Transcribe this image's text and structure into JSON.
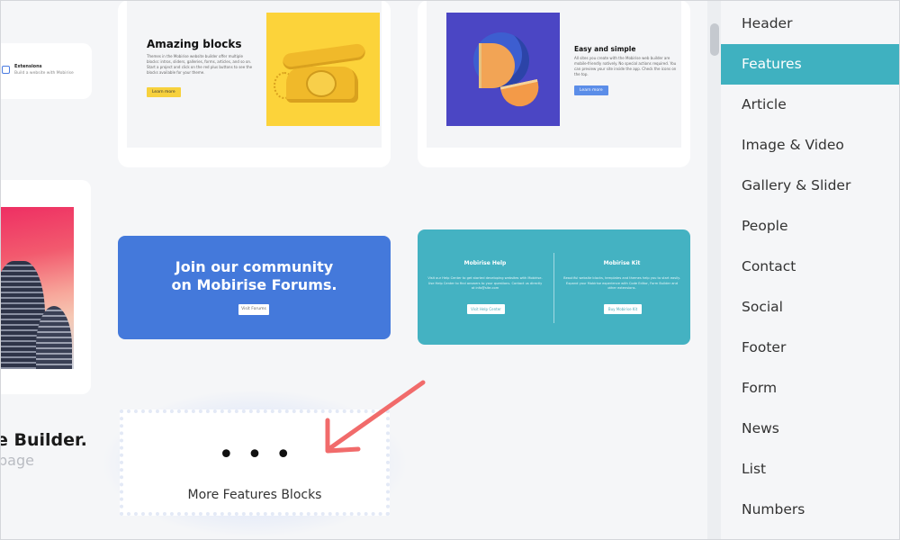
{
  "left_column": {
    "extensions_card": {
      "title": "Extensions",
      "subtitle": "Build a website with Mobirise",
      "icon": "extensions-icon"
    },
    "builder_title": "e Builder.",
    "builder_subtitle": "page"
  },
  "cards": {
    "amazing": {
      "title": "Amazing blocks",
      "text": "Themes in the Mobirise website builder offer multiple blocks: intros, sliders, galleries, forms, articles, and so on. Start a project and click on the red plus buttons to see the blocks available for your theme.",
      "button": "Learn more",
      "button_color": "#f7d13d"
    },
    "easy": {
      "title": "Easy and simple",
      "text": "All sites you create with the Mobirise web builder are mobile-friendly natively. No special actions required. You can preview your site inside the app. Check the icons on the top.",
      "button": "Learn more",
      "button_color": "#5b8de8"
    },
    "join": {
      "title_line1": "Join our community",
      "title_line2": "on Mobirise Forums.",
      "button": "Visit Forums",
      "bg_color": "#4479db"
    },
    "help": {
      "bg_color": "#44b2c2",
      "left": {
        "title": "Mobirise Help",
        "text": "Visit our Help Center to get started developing websites with Mobirise. Use Help Center to find answers to your questions. Contact us directly at info@site.com",
        "button": "Visit Help Center"
      },
      "right": {
        "title": "Mobirise Kit",
        "text": "Beautiful website blocks, templates and themes help you to start easily. Expand your Mobirise experience with Code Editor, Form Builder and other extensions.",
        "button": "Buy Mobirise Kit"
      }
    },
    "more": {
      "dots": "•••",
      "label": "More Features Blocks"
    }
  },
  "arrow_color": "#f16b6b",
  "sidebar": {
    "active_color": "#3fb1c0",
    "items": [
      {
        "label": "Header",
        "active": false
      },
      {
        "label": "Features",
        "active": true
      },
      {
        "label": "Article",
        "active": false
      },
      {
        "label": "Image & Video",
        "active": false
      },
      {
        "label": "Gallery & Slider",
        "active": false
      },
      {
        "label": "People",
        "active": false
      },
      {
        "label": "Contact",
        "active": false
      },
      {
        "label": "Social",
        "active": false
      },
      {
        "label": "Footer",
        "active": false
      },
      {
        "label": "Form",
        "active": false
      },
      {
        "label": "News",
        "active": false
      },
      {
        "label": "List",
        "active": false
      },
      {
        "label": "Numbers",
        "active": false
      }
    ]
  }
}
